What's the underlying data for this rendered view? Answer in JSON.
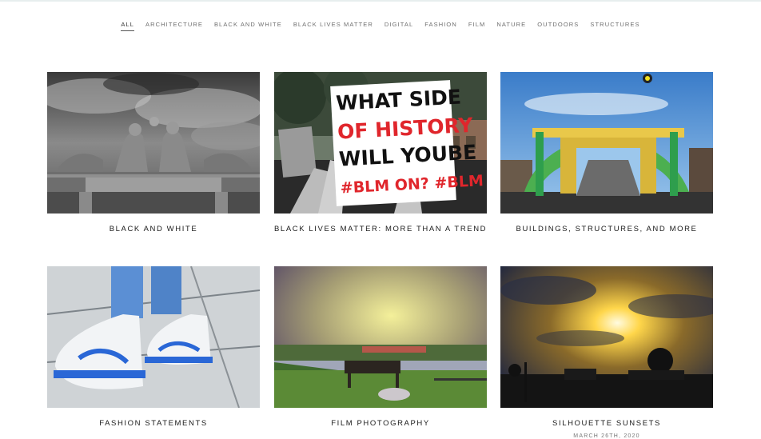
{
  "filters": {
    "items": [
      {
        "label": "ALL",
        "active": true
      },
      {
        "label": "ARCHITECTURE"
      },
      {
        "label": "BLACK AND WHITE"
      },
      {
        "label": "BLACK LIVES MATTER"
      },
      {
        "label": "DIGITAL"
      },
      {
        "label": "FASHION"
      },
      {
        "label": "FILM"
      },
      {
        "label": "NATURE"
      },
      {
        "label": "OUTDOORS"
      },
      {
        "label": "STRUCTURES"
      }
    ]
  },
  "galleries": [
    {
      "title": "BLACK AND WHITE",
      "image": "sculpture-bw-photo"
    },
    {
      "title": "BLACK LIVES MATTER: MORE THAN A TREND",
      "image": "protest-sign-photo",
      "sign_lines": [
        "WHAT SIDE",
        "OF HISTORY",
        "WILL YOUBE",
        "#BLM ON? #BLM"
      ]
    },
    {
      "title": "BUILDINGS, STRUCTURES, AND MORE",
      "image": "bridge-photo"
    },
    {
      "title": "FASHION STATEMENTS",
      "image": "sneakers-photo"
    },
    {
      "title": "FILM PHOTOGRAPHY",
      "image": "park-bench-photo"
    },
    {
      "title": "SILHOUETTE SUNSETS",
      "image": "sunset-photo",
      "date": "MARCH 26TH, 2020"
    }
  ],
  "colors": {
    "accent_text": "#1a1a1a",
    "nav_text": "#6f6f6f",
    "sign_red": "#e0262c"
  }
}
